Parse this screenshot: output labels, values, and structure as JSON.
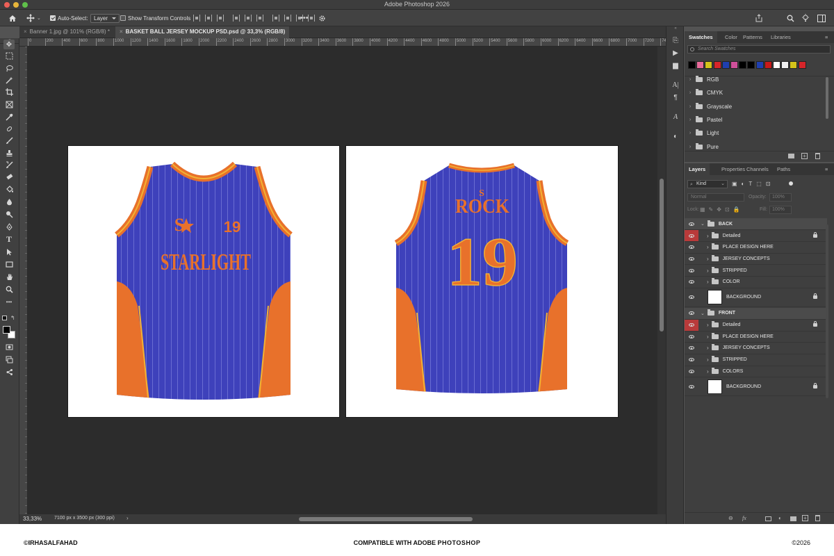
{
  "app": {
    "title": "Adobe Photoshop 2026"
  },
  "options": {
    "auto_select_label": "Auto-Select:",
    "auto_select_value": "Layer",
    "transform_label": "Show Transform Controls"
  },
  "tabs": [
    {
      "label": "Banner 1.jpg @ 101% (RGB/8) *"
    },
    {
      "label": "BASKET BALL JERSEY MOCKUP PSD.psd @ 33,3% (RGB/8)"
    }
  ],
  "ruler": [
    "0",
    "200",
    "400",
    "600",
    "800",
    "1000",
    "1200",
    "1400",
    "1600",
    "1800",
    "2000",
    "2200",
    "2400",
    "2600",
    "2800",
    "3000",
    "3200",
    "3400",
    "3600",
    "3800",
    "4000",
    "4200",
    "4400",
    "4600",
    "4800",
    "5000",
    "5200",
    "5400",
    "5600",
    "5800",
    "6000",
    "6200",
    "6400",
    "6600",
    "6800",
    "7000",
    "7200",
    "7400"
  ],
  "status": {
    "zoom": "33,33%",
    "doc_info": "7100 px x 3500 px (300 ppi)"
  },
  "jersey_front": {
    "logo": "S",
    "number": "19",
    "team": "STARLIGHT"
  },
  "jersey_back": {
    "logo": "S",
    "name": "ROCK",
    "number": "19"
  },
  "jersey_colors": {
    "body": "#3d3fb8",
    "trim": "#e8712b",
    "stripe": "#f2b233"
  },
  "swatches_panel": {
    "tabs": [
      "Swatches",
      "Color",
      "Patterns",
      "Libraries"
    ],
    "search_placeholder": "Search Swatches",
    "colors": [
      "#000000",
      "#e86a9a",
      "#d4c21a",
      "#d6252a",
      "#1f3fb0",
      "#d0509a",
      "#000000",
      "#000000",
      "#1f3fb0",
      "#c81a1a",
      "#ffffff",
      "#f0f0f0",
      "#d4c21a",
      "#d6252a"
    ],
    "folders": [
      "RGB",
      "CMYK",
      "Grayscale",
      "Pastel",
      "Light",
      "Pure"
    ]
  },
  "layers_panel": {
    "tabs": [
      "Layers",
      "Properties",
      "Channels",
      "Paths"
    ],
    "kind": "Kind",
    "blend_mode": "Normal",
    "opacity_label": "Opacity:",
    "opacity_value": "100%",
    "lock_label": "Lock:",
    "fill_label": "Fill:",
    "fill_value": "100%",
    "groups": [
      {
        "name": "BACK",
        "layers": [
          "Detailed",
          "PLACE DESIGN HERE",
          "JERSEY CONCEPTS",
          "STRIPPED",
          "COLOR"
        ],
        "background": "BACKGROUND"
      },
      {
        "name": "FRONT",
        "layers": [
          "Detailed",
          "PLACE DESIGN HERE",
          "JERSEY CONCEPTS",
          "STRIPPED",
          "COLORS"
        ],
        "background": "BACKGROUND"
      }
    ]
  },
  "footer": {
    "left": "©IRHASALFAHAD",
    "center_prefix": "COMPATIBLE WITH ADOBE ",
    "center_brand": "PHOTOSHOP",
    "right": "©2026"
  }
}
